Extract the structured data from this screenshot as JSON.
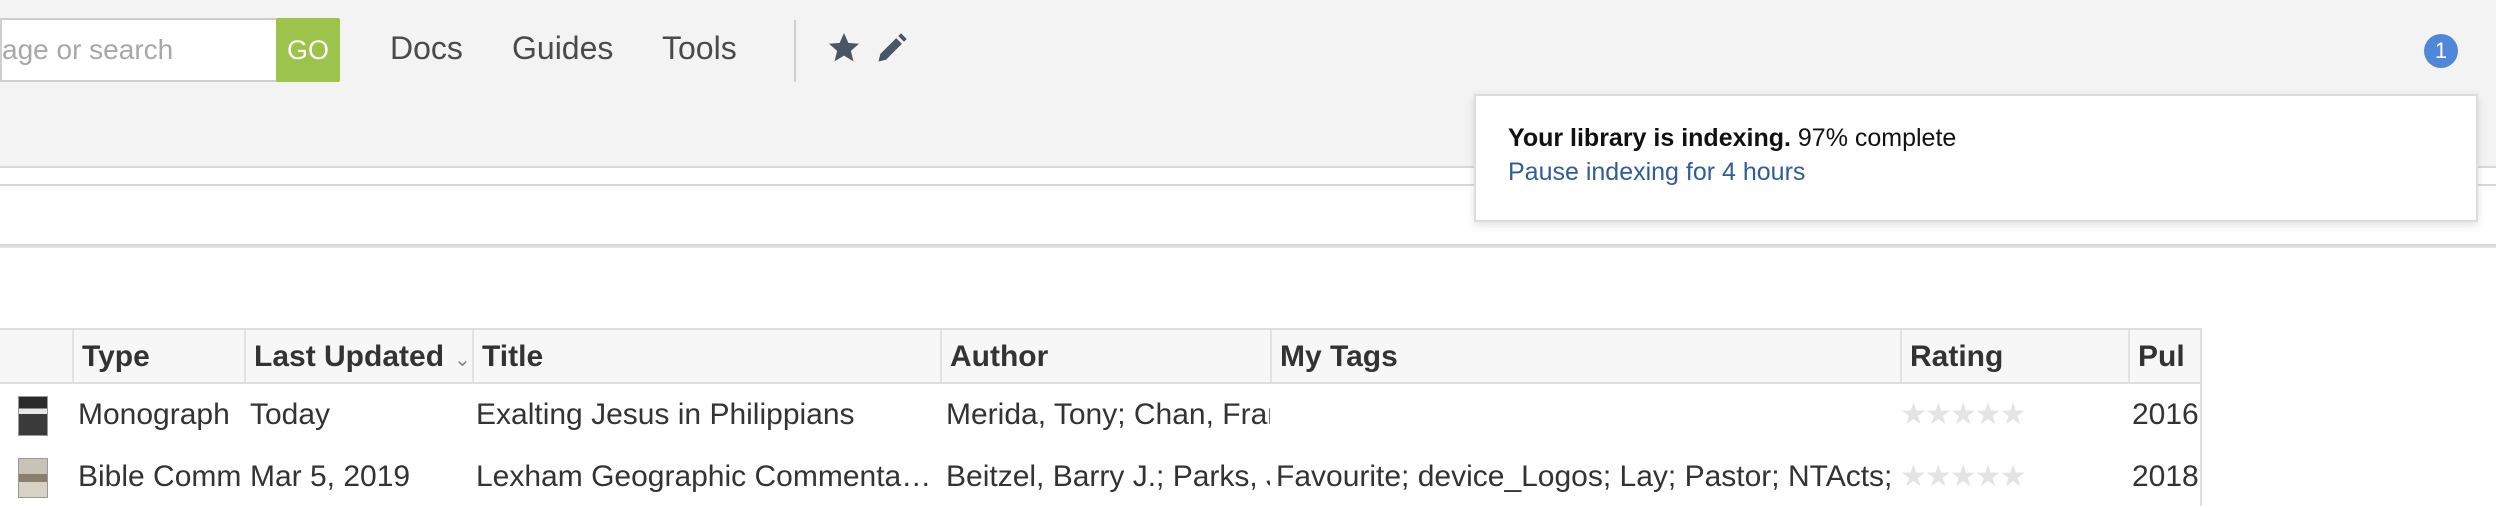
{
  "toolbar": {
    "search_placeholder": "sage or search",
    "go_label": "GO",
    "nav": [
      "Docs",
      "Guides",
      "Tools"
    ],
    "icons": [
      "star-icon",
      "pencil-icon"
    ],
    "notification_count": "1"
  },
  "indexing_popover": {
    "title": "Your library is indexing.",
    "progress_text": "97% complete",
    "progress_percent": 97,
    "pause_link": "Pause indexing for 4 hours"
  },
  "table": {
    "columns": [
      "Type",
      "Last Updated",
      "Title",
      "Author",
      "My Tags",
      "Rating",
      "Pul"
    ],
    "rows": [
      {
        "type": "Monograph",
        "last_updated": "Today",
        "title": "Exalting Jesus in Philippians",
        "author": "Merida, Tony; Chan, Fran",
        "tags": "",
        "rating_stars": "★★★★★",
        "rating_value": 0,
        "published": "2016"
      },
      {
        "type": "Bible Comm",
        "last_updated": "Mar 5, 2019",
        "title": "Lexham Geographic Commentar…",
        "author": "Beitzel, Barry J.; Parks, Je",
        "tags": "Favourite; device_Logos; Lay; Pastor; NTActs; NT",
        "rating_stars": "★★★★★",
        "rating_value": 0,
        "published": "2018"
      }
    ]
  },
  "colors": {
    "go_button": "#9cc34b",
    "link": "#2f5d9a",
    "badge": "#4f88d8"
  }
}
